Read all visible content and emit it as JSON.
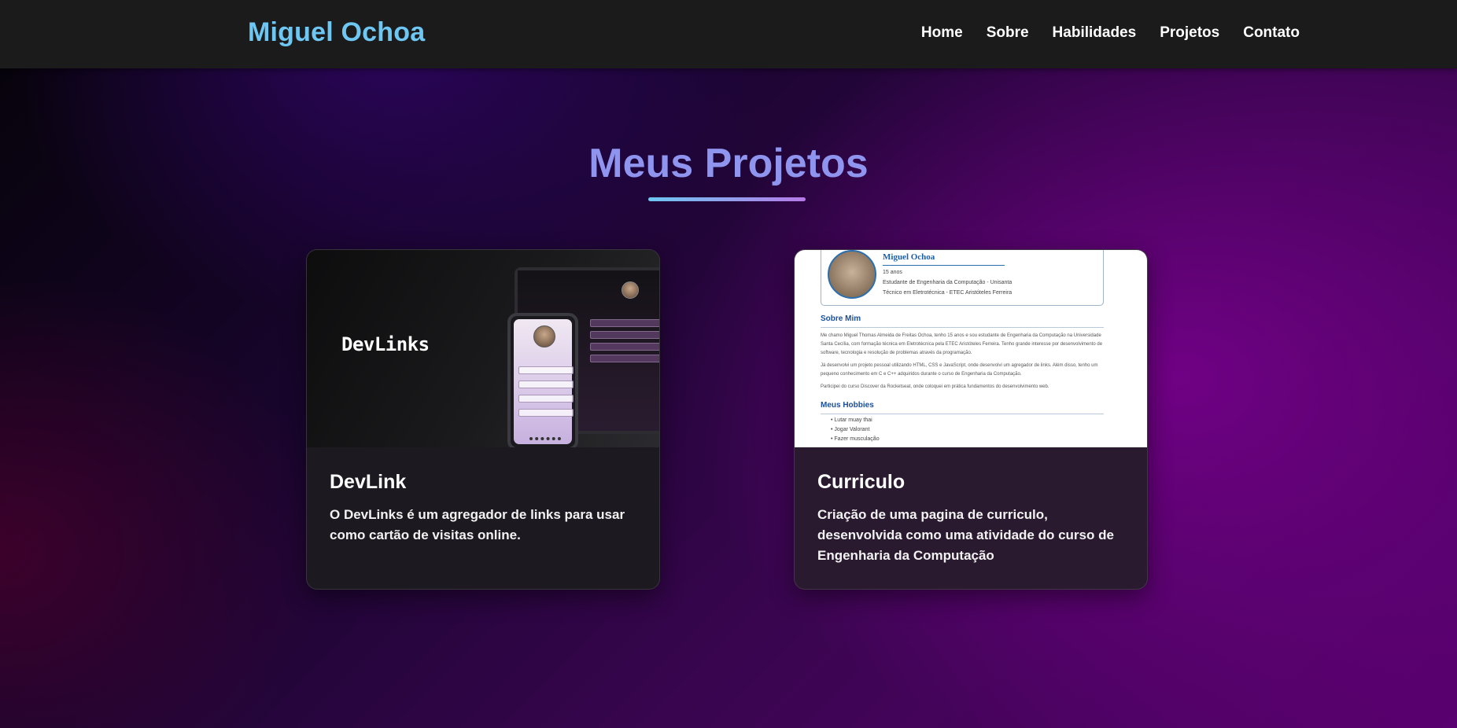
{
  "header": {
    "brand": "Miguel Ochoa",
    "nav": [
      "Home",
      "Sobre",
      "Habilidades",
      "Projetos",
      "Contato"
    ]
  },
  "section": {
    "title": "Meus Projetos"
  },
  "projects": [
    {
      "title": "DevLink",
      "description": "O DevLinks é um agregador de links para usar como cartão de visitas online.",
      "image": {
        "logo_text": "DevLinks"
      }
    },
    {
      "title": "Curriculo",
      "description": "Criação de uma pagina de curriculo, desenvolvida como uma atividade do curso de Engenharia da Computação",
      "image": {
        "name": "Miguel Ochoa",
        "lines": [
          "15 anos",
          "Estudante de Engenharia da Computação - Unisanta",
          "Técnico em Eletrotécnica - ETEC Aristóteles Ferreira"
        ],
        "about_heading": "Sobre Mim",
        "paragraphs": [
          "Me chamo Miguel Thomas Almeida de Freitas Ochoa, tenho 15 anos e sou estudante de Engenharia da Computação na Universidade Santa Cecília, com formação técnica em Eletrotécnica pela ETEC Aristóteles Ferreira. Tenho grande interesse por desenvolvimento de software, tecnologia e resolução de problemas através da programação.",
          "Já desenvolvi um projeto pessoal utilizando HTML, CSS e JavaScript, onde desenvolvi um agregador de links. Além disso, tenho um pequeno conhecimento em C e C++ adquiridos durante o curso de Engenharia da Computação.",
          "Participei do curso Discover da Rocketseat, onde coloquei em prática fundamentos do desenvolvimento web."
        ],
        "hobbies_heading": "Meus Hobbies",
        "hobbies": [
          "Lutar muay thai",
          "Jogar Valorant",
          "Fazer musculação"
        ]
      }
    }
  ],
  "colors": {
    "brand": "#6ec7f2",
    "title": "#8f94ee",
    "header_bg": "#1b1b1c"
  }
}
